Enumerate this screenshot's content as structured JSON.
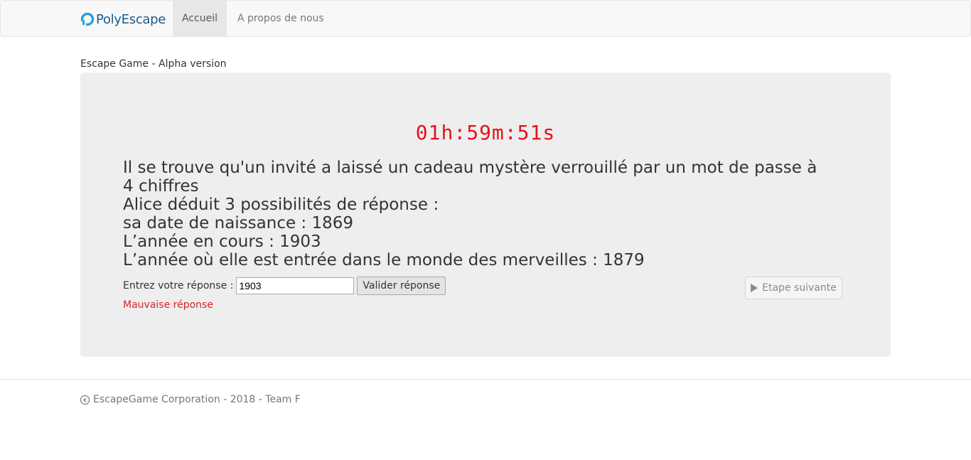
{
  "nav": {
    "brand": "PolyEscape",
    "items": [
      {
        "label": "Accueil",
        "active": true
      },
      {
        "label": "A propos de nous",
        "active": false
      }
    ]
  },
  "subtitle": "Escape Game - Alpha version",
  "game": {
    "timer": "01h:59m:51s",
    "question_lines": [
      "Il se trouve qu'un invité a laissé un cadeau mystère verrouillé par un mot de passe à 4 chiffres",
      "Alice déduit 3 possibilités de réponse :",
      "sa date de naissance : 1869",
      "L’année en cours : 1903",
      "L’année où elle est entrée dans le monde des merveilles : 1879"
    ],
    "answer_label": "Entrez votre réponse :",
    "answer_value": "1903",
    "validate_label": "Valider réponse",
    "error_message": "Mauvaise réponse",
    "next_label": "Etape suivante"
  },
  "footer": {
    "text": "EscapeGame Corporation - 2018 - Team F"
  },
  "colors": {
    "timer": "#e8101a",
    "error": "#d9262c",
    "brand": "#1a5b8c",
    "panel": "#eeeeee"
  },
  "icons": {
    "brand_logo": "polyescape-logo-icon",
    "next": "play-icon",
    "footer": "copyright-icon"
  }
}
